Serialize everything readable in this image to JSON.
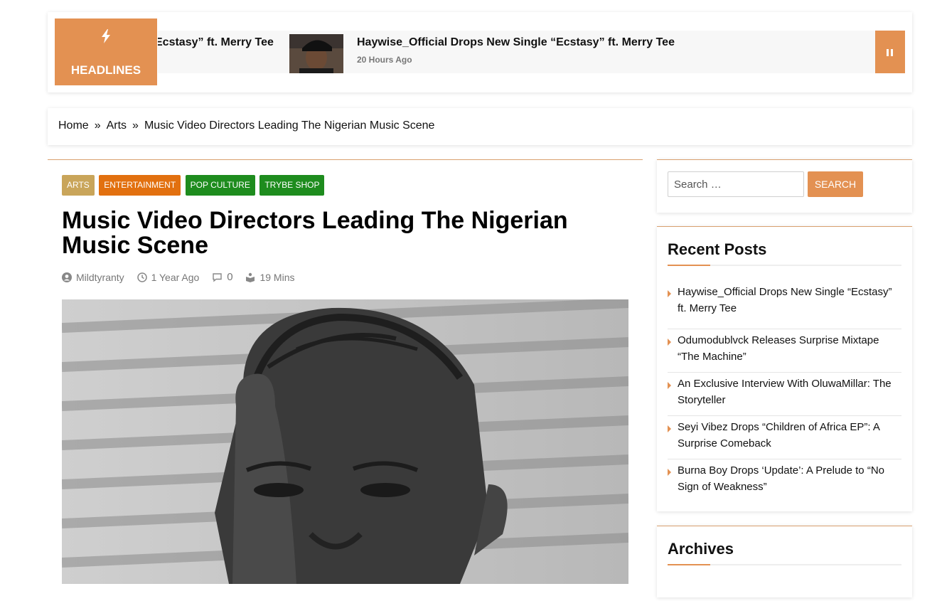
{
  "ticker": {
    "label": "HEADLINES",
    "partial_title": "Ecstasy” ft. Merry Tee",
    "item": {
      "title": "Haywise_Official Drops New Single “Ecstasy” ft. Merry Tee",
      "time": "20 Hours Ago"
    },
    "accent_color": "#e39152"
  },
  "breadcrumb": [
    "Home",
    "Arts",
    "Music Video Directors Leading The Nigerian Music Scene"
  ],
  "article": {
    "categories": [
      {
        "label": "ARTS",
        "color": "#c9a55a"
      },
      {
        "label": "ENTERTAINMENT",
        "color": "#e2700f"
      },
      {
        "label": "POP CULTURE",
        "color": "#1e8c1e"
      },
      {
        "label": "TRYBE SHOP",
        "color": "#1e8c1e"
      }
    ],
    "title": "Music Video Directors Leading The Nigerian Music Scene",
    "author": "Mildtyranty",
    "date": "1 Year Ago",
    "comments": "0",
    "read_time": "19 Mins"
  },
  "sidebar": {
    "search": {
      "placeholder": "Search …",
      "button": "SEARCH"
    },
    "recent_posts": {
      "title": "Recent Posts",
      "items": [
        "Haywise_Official Drops New Single “Ecstasy” ft. Merry Tee",
        "Odumodublvck Releases Surprise Mixtape “The Machine”",
        "An Exclusive Interview With OluwaMillar: The Storyteller",
        "Seyi Vibez Drops “Children of Africa EP”: A Surprise Comeback",
        "Burna Boy Drops ‘Update’: A Prelude to “No Sign of Weakness”"
      ]
    },
    "archives": {
      "title": "Archives"
    }
  }
}
